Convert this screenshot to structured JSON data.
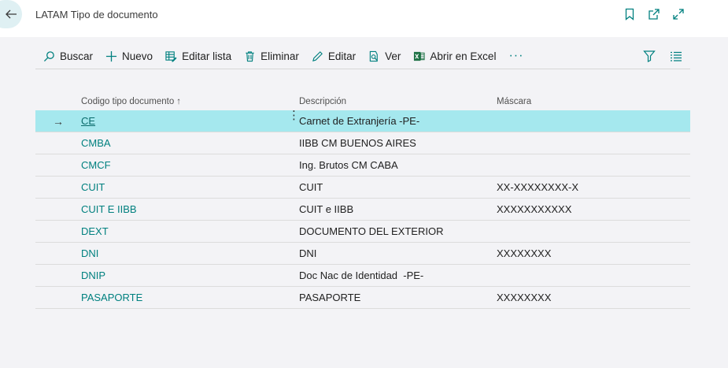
{
  "header": {
    "title": "LATAM Tipo de documento",
    "icons": [
      "back-arrow-icon",
      "bookmark-icon",
      "open-new-window-icon",
      "expand-icon"
    ]
  },
  "toolbar": {
    "buscar": "Buscar",
    "nuevo": "Nuevo",
    "editar_lista": "Editar lista",
    "eliminar": "Eliminar",
    "editar": "Editar",
    "ver": "Ver",
    "abrir_excel": "Abrir en Excel",
    "more": "···"
  },
  "colors": {
    "accent": "#00807f",
    "selected_row": "#a5e8ee",
    "excel": "#1e7145"
  },
  "table": {
    "headers": {
      "code": "Codigo tipo documento",
      "sort": "↑",
      "desc": "Descripción",
      "mask": "Máscara"
    },
    "rows": [
      {
        "arrow": "→",
        "code": "CE",
        "menu": "⋮",
        "desc": "Carnet de Extranjería -PE-",
        "mask": ""
      },
      {
        "arrow": "",
        "code": "CMBA",
        "menu": "",
        "desc": "IIBB CM BUENOS AIRES",
        "mask": ""
      },
      {
        "arrow": "",
        "code": "CMCF",
        "menu": "",
        "desc": "Ing. Brutos CM CABA",
        "mask": ""
      },
      {
        "arrow": "",
        "code": "CUIT",
        "menu": "",
        "desc": "CUIT",
        "mask": "XX-XXXXXXXX-X"
      },
      {
        "arrow": "",
        "code": "CUIT E IIBB",
        "menu": "",
        "desc": "CUIT e IIBB",
        "mask": "XXXXXXXXXXX"
      },
      {
        "arrow": "",
        "code": "DEXT",
        "menu": "",
        "desc": "DOCUMENTO DEL EXTERIOR",
        "mask": ""
      },
      {
        "arrow": "",
        "code": "DNI",
        "menu": "",
        "desc": "DNI",
        "mask": "XXXXXXXX"
      },
      {
        "arrow": "",
        "code": "DNIP",
        "menu": "",
        "desc": "Doc Nac de Identidad  -PE-",
        "mask": ""
      },
      {
        "arrow": "",
        "code": "PASAPORTE",
        "menu": "",
        "desc": "PASAPORTE",
        "mask": "XXXXXXXX"
      }
    ]
  }
}
